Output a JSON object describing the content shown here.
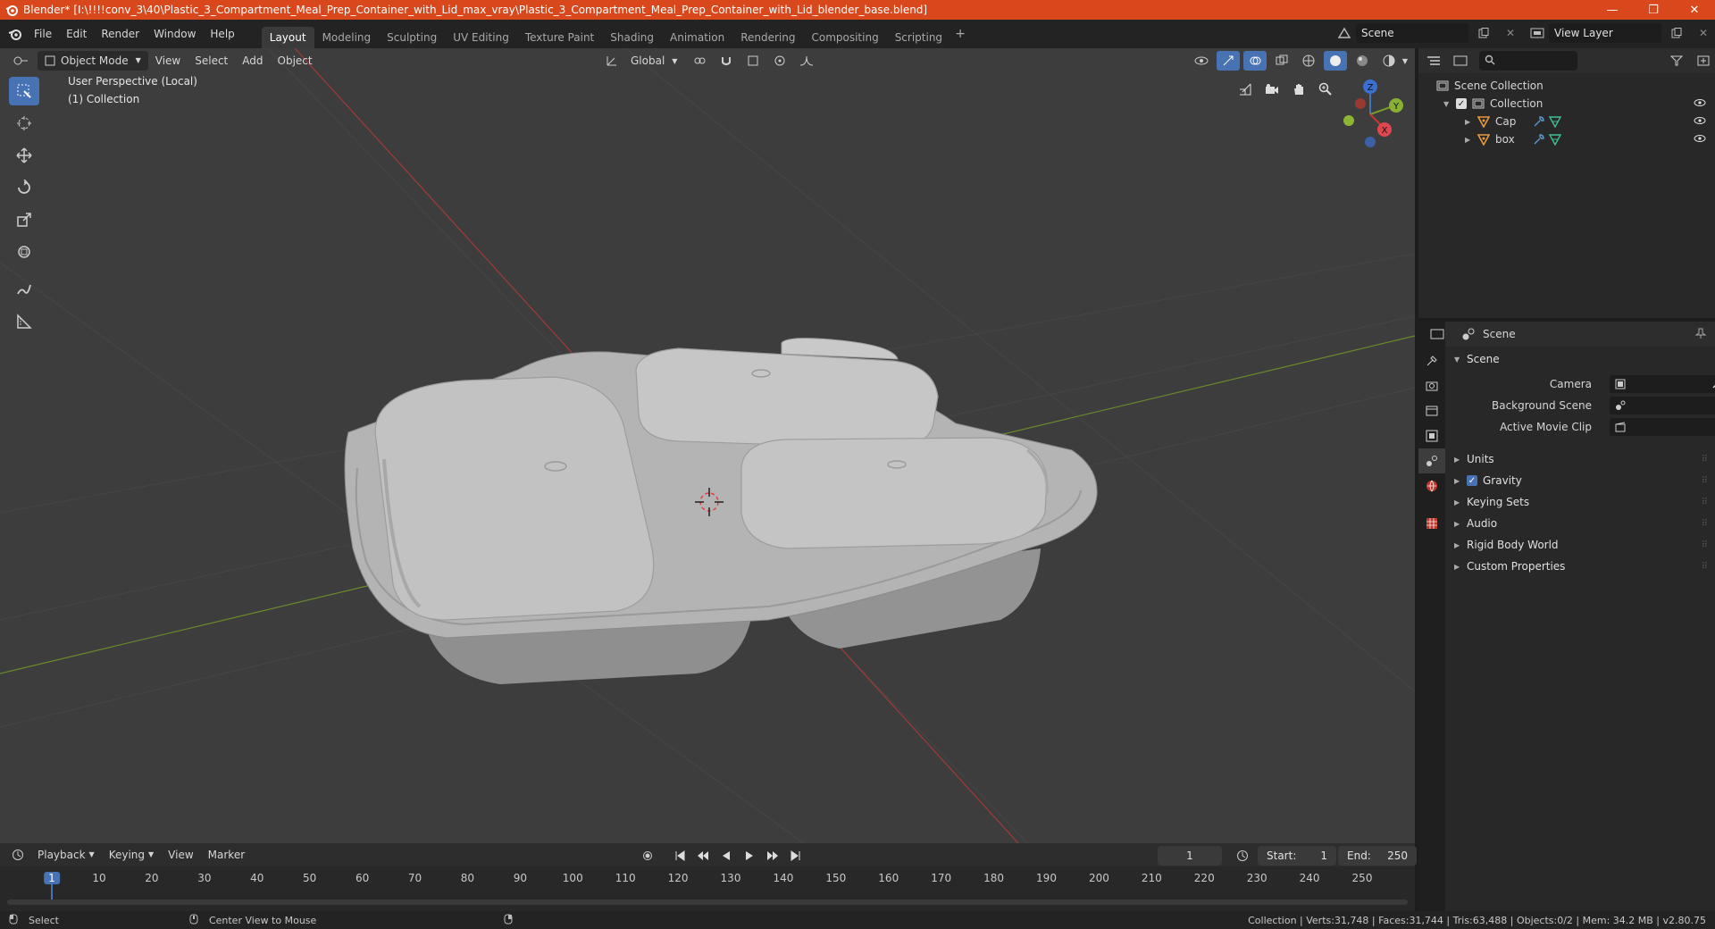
{
  "titlebar": {
    "title": "Blender* [I:\\!!!!conv_3\\40\\Plastic_3_Compartment_Meal_Prep_Container_with_Lid_max_vray\\Plastic_3_Compartment_Meal_Prep_Container_with_Lid_blender_base.blend]",
    "minimize": "—",
    "maximize": "❐",
    "close": "✕"
  },
  "menu": {
    "file": "File",
    "edit": "Edit",
    "render": "Render",
    "window": "Window",
    "help": "Help"
  },
  "workspaces": [
    "Layout",
    "Modeling",
    "Sculpting",
    "UV Editing",
    "Texture Paint",
    "Shading",
    "Animation",
    "Rendering",
    "Compositing",
    "Scripting"
  ],
  "active_workspace": "Layout",
  "scene_field": "Scene",
  "view_layer_field": "View Layer",
  "viewport": {
    "mode": "Object Mode",
    "menus": {
      "view": "View",
      "select": "Select",
      "add": "Add",
      "object": "Object"
    },
    "transform": "Global",
    "overlay_line1": "User Perspective (Local)",
    "overlay_line2": "(1) Collection",
    "gizmo": {
      "x": "X",
      "y": "Y",
      "z": "Z"
    }
  },
  "outliner": {
    "root": "Scene Collection",
    "collection": "Collection",
    "items": [
      "Cap",
      "box"
    ]
  },
  "properties": {
    "header": "Scene",
    "section": "Scene",
    "camera_label": "Camera",
    "background_scene_label": "Background Scene",
    "active_movie_clip_label": "Active Movie Clip",
    "subsections": [
      "Units",
      "Gravity",
      "Keying Sets",
      "Audio",
      "Rigid Body World",
      "Custom Properties"
    ],
    "gravity_checked": true
  },
  "timeline": {
    "menus": {
      "playback": "Playback",
      "keying": "Keying",
      "view": "View",
      "marker": "Marker"
    },
    "current_frame": "1",
    "start_label": "Start:",
    "start_value": "1",
    "end_label": "End:",
    "end_value": "250",
    "ticks": [
      "1",
      "10",
      "20",
      "30",
      "40",
      "50",
      "60",
      "70",
      "80",
      "90",
      "100",
      "110",
      "120",
      "130",
      "140",
      "150",
      "160",
      "170",
      "180",
      "190",
      "200",
      "210",
      "220",
      "230",
      "240",
      "250"
    ]
  },
  "statusbar": {
    "select": "Select",
    "center": "Center View to Mouse",
    "stats": "Collection | Verts:31,748 | Faces:31,744 | Tris:63,488 | Objects:0/2 | Mem: 34.2 MB | v2.80.75"
  },
  "colors": {
    "titlebar": "#d9481d",
    "accent": "#4772b3",
    "axis_x": "#c0392b",
    "axis_y": "#7a9a2a",
    "viewport_bg": "#3d3d3d"
  }
}
